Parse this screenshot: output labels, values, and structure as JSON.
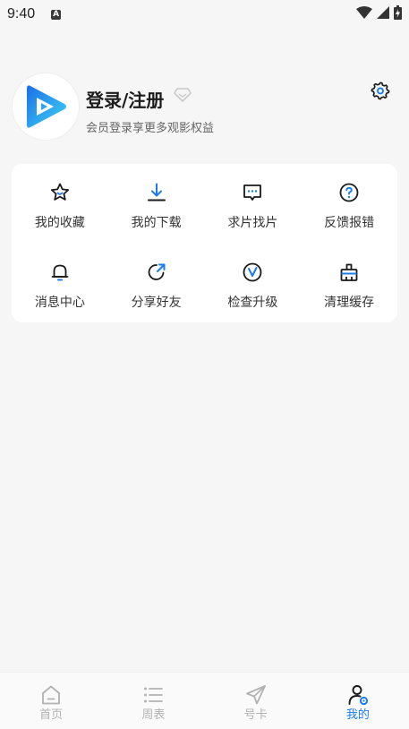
{
  "status_bar": {
    "time": "9:40",
    "notification_icon": "A"
  },
  "profile": {
    "title": "登录/注册",
    "subtitle": "会员登录享更多观影权益",
    "avatar_icon": "play-logo-icon",
    "vip_icon": "diamond-icon",
    "settings_icon": "gear-icon"
  },
  "grid": [
    {
      "label": "我的收藏",
      "icon": "star-icon"
    },
    {
      "label": "我的下载",
      "icon": "download-icon"
    },
    {
      "label": "求片找片",
      "icon": "message-icon"
    },
    {
      "label": "反馈报错",
      "icon": "question-icon"
    },
    {
      "label": "消息中心",
      "icon": "bell-icon"
    },
    {
      "label": "分享好友",
      "icon": "share-icon"
    },
    {
      "label": "检查升级",
      "icon": "upgrade-icon"
    },
    {
      "label": "清理缓存",
      "icon": "clean-icon"
    }
  ],
  "tabs": [
    {
      "label": "首页",
      "icon": "home-icon",
      "active": false
    },
    {
      "label": "周表",
      "icon": "list-icon",
      "active": false
    },
    {
      "label": "号卡",
      "icon": "send-icon",
      "active": false
    },
    {
      "label": "我的",
      "icon": "user-settings-icon",
      "active": true
    }
  ],
  "colors": {
    "accent": "#1a7cf0",
    "background": "#f6f6f7",
    "icon_dark": "#1a1a1a",
    "tab_inactive": "#b2b2b2"
  }
}
